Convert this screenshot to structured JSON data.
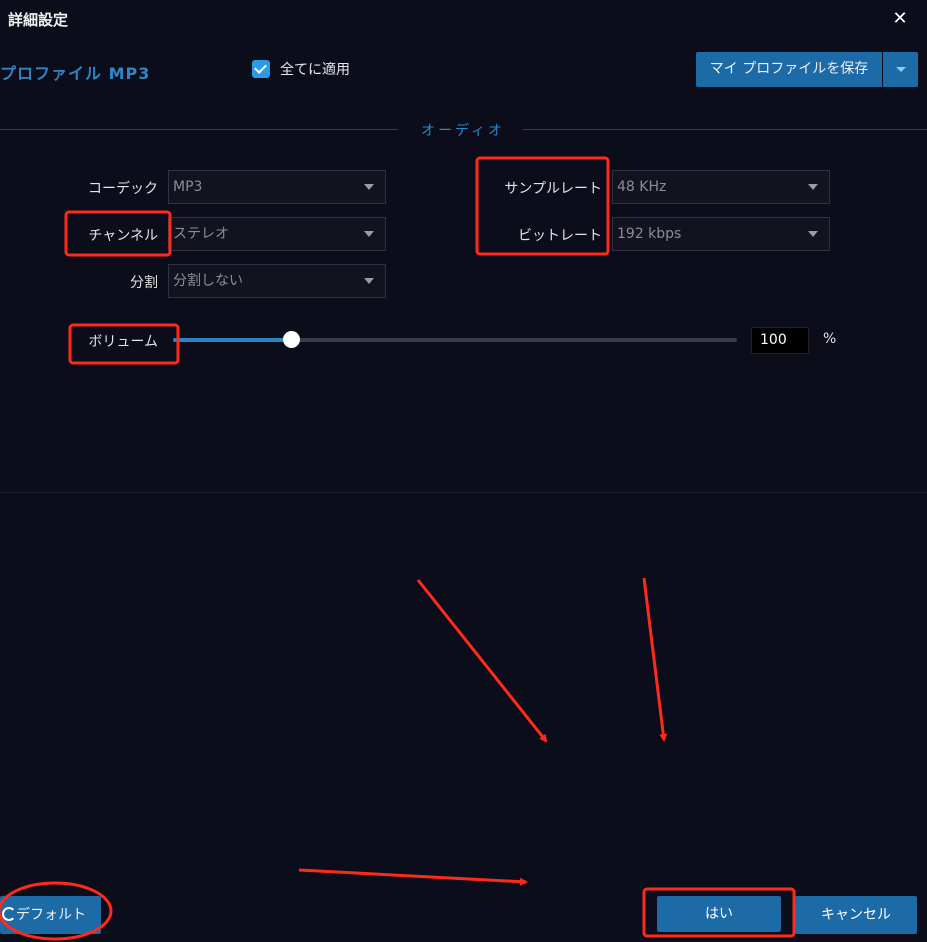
{
  "window": {
    "title": "詳細設定",
    "close_glyph": "✕"
  },
  "profile": {
    "label": "プロファイル MP3",
    "apply_all_checked": true,
    "apply_all_label": "全てに適用",
    "save_button_label": "マイ プロファイルを保存"
  },
  "section": {
    "title": "オーディオ"
  },
  "audio": {
    "codec": {
      "label": "コーデック",
      "value": "MP3"
    },
    "channel": {
      "label": "チャンネル",
      "value": "ステレオ"
    },
    "split": {
      "label": "分割",
      "value": "分割しない"
    },
    "sample_rate": {
      "label": "サンプルレート",
      "value": "48 KHz"
    },
    "bitrate": {
      "label": "ビットレート",
      "value": "192 kbps"
    },
    "volume": {
      "label": "ボリューム",
      "value": "100",
      "unit": "%",
      "slider_fraction": 0.21
    }
  },
  "buttons": {
    "default_label": "デフォルト",
    "yes_label": "はい",
    "cancel_label": "キャンセル"
  },
  "colors": {
    "accent": "#1c6aa6",
    "title_accent": "#2f86c6",
    "annotation": "#ff2a1a",
    "background": "#0c0d1a"
  }
}
